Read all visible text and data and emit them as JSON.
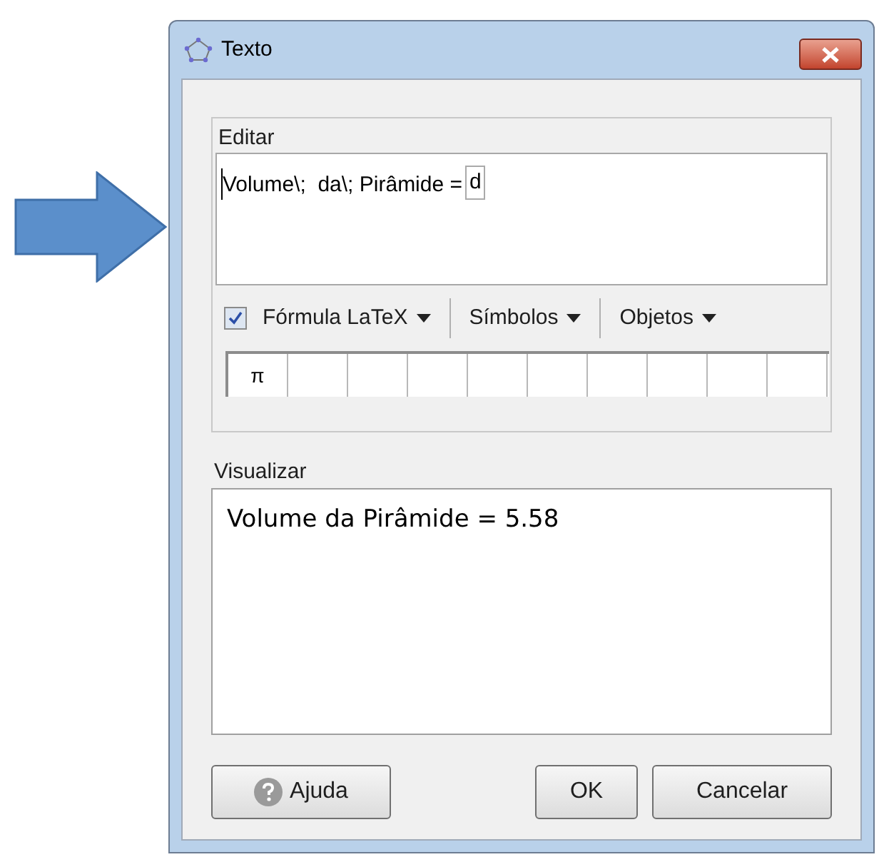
{
  "window": {
    "title": "Texto"
  },
  "edit": {
    "label": "Editar",
    "text": "Volume\\;  da\\; Pirâmide =",
    "object_box": "d",
    "latex": {
      "label": "Fórmula LaTeX",
      "checked": true
    },
    "menus": [
      "Símbolos",
      "Objetos"
    ],
    "symbols": [
      "π"
    ]
  },
  "preview": {
    "label": "Visualizar",
    "text": "Volume da Pirâmide = 5.58"
  },
  "buttons": [
    {
      "kind": "help",
      "label": "Ajuda"
    },
    {
      "kind": "plain",
      "label": "OK"
    },
    {
      "kind": "plain",
      "label": "Cancelar"
    }
  ]
}
